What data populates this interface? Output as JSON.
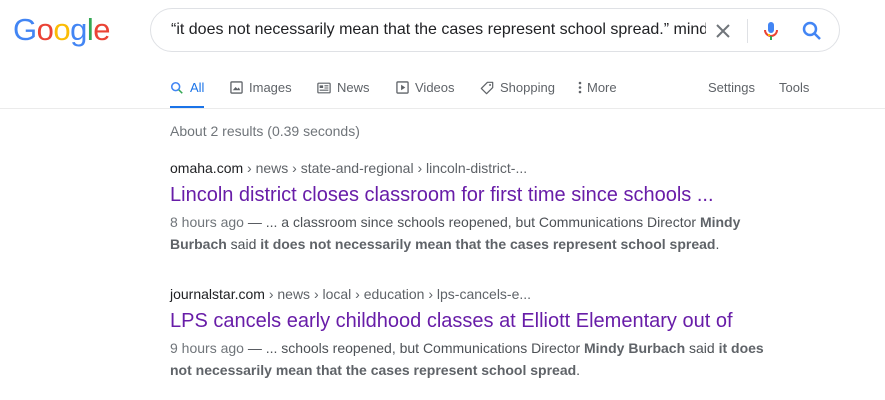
{
  "logo": {
    "letters": [
      "G",
      "o",
      "o",
      "g",
      "l",
      "e"
    ]
  },
  "search": {
    "query": "“it does not necessarily mean that the cases represent school spread.” mindy burbach"
  },
  "tabs": [
    {
      "label": "All",
      "icon": "search-icon",
      "active": true
    },
    {
      "label": "Images",
      "icon": "image-icon"
    },
    {
      "label": "News",
      "icon": "news-icon"
    },
    {
      "label": "Videos",
      "icon": "video-icon"
    },
    {
      "label": "Shopping",
      "icon": "tag-icon"
    },
    {
      "label": "More",
      "icon": "more-vert-icon"
    }
  ],
  "tools": {
    "settings": "Settings",
    "tools": "Tools"
  },
  "stats": "About 2 results (0.39 seconds)",
  "results": [
    {
      "domain": "omaha.com",
      "path": " › news › state-and-regional › lincoln-district-...",
      "title": "Lincoln district closes classroom for first time since schools ...",
      "date": "8 hours ago",
      "sep": " — ",
      "snippet_pre": "... a classroom since schools reopened, but Communications Director ",
      "snippet_b1": "Mindy Burbach",
      "snippet_mid": " said ",
      "snippet_b2": "it does not necessarily mean that the cases represent school spread",
      "snippet_post": "."
    },
    {
      "domain": "journalstar.com",
      "path": " › news › local › education › lps-cancels-e...",
      "title": "LPS cancels early childhood classes at Elliott Elementary out of",
      "date": "9 hours ago",
      "sep": " — ",
      "snippet_pre": "... schools reopened, but Communications Director ",
      "snippet_b1": "Mindy Burbach",
      "snippet_mid": " said ",
      "snippet_b2": "it does not necessarily mean that the cases represent school spread",
      "snippet_post": "."
    }
  ],
  "colors": {
    "blue": "#4285F4",
    "red": "#EA4335",
    "yellow": "#FBBC05",
    "green": "#34A853",
    "link_visited": "#681da8",
    "active_tab": "#1a73e8"
  }
}
